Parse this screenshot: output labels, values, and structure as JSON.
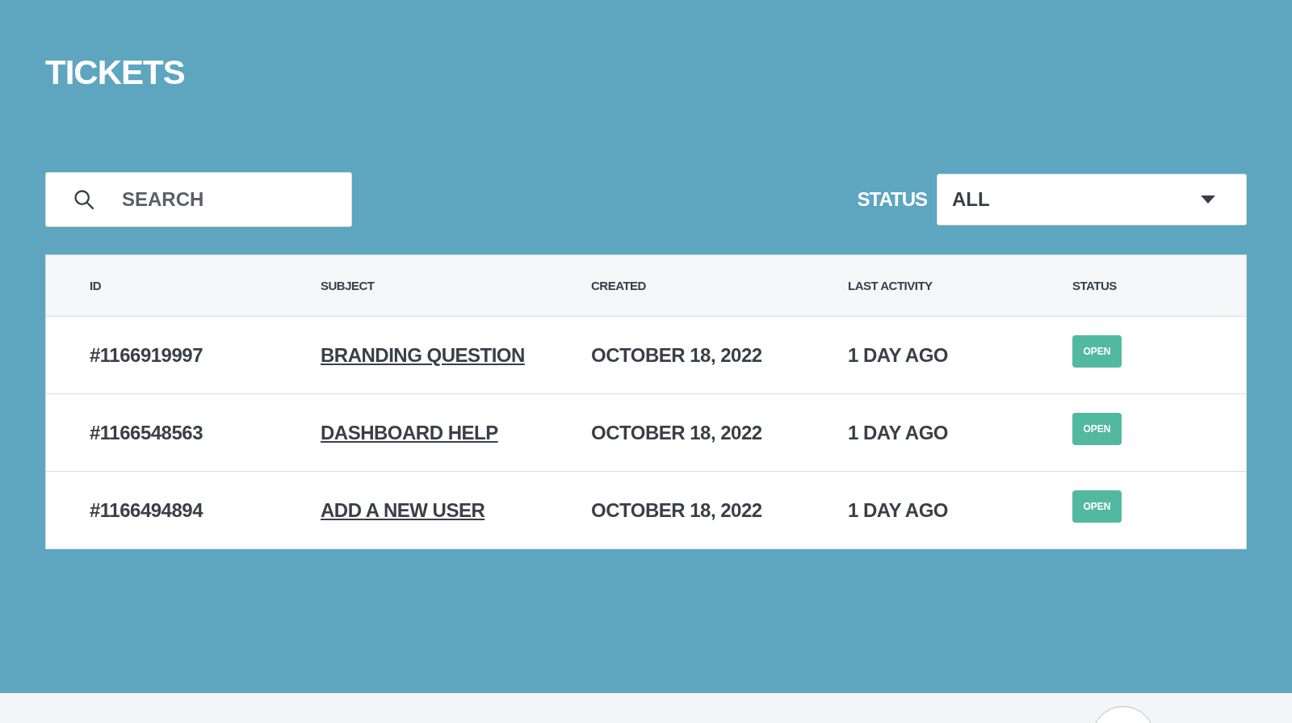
{
  "title": "TICKETS",
  "search": {
    "placeholder": "SEARCH"
  },
  "status_filter": {
    "label": "STATUS",
    "value": "ALL"
  },
  "table": {
    "columns": [
      "ID",
      "SUBJECT",
      "CREATED",
      "LAST ACTIVITY",
      "STATUS"
    ],
    "rows": [
      {
        "id": "#1166919997",
        "subject": "BRANDING QUESTION",
        "created": "OCTOBER 18, 2022",
        "last_activity": "1 DAY AGO",
        "status": "OPEN"
      },
      {
        "id": "#1166548563",
        "subject": "DASHBOARD HELP",
        "created": "OCTOBER 18, 2022",
        "last_activity": "1 DAY AGO",
        "status": "OPEN"
      },
      {
        "id": "#1166494894",
        "subject": "ADD A NEW USER",
        "created": "OCTOBER 18, 2022",
        "last_activity": "1 DAY AGO",
        "status": "OPEN"
      }
    ]
  }
}
